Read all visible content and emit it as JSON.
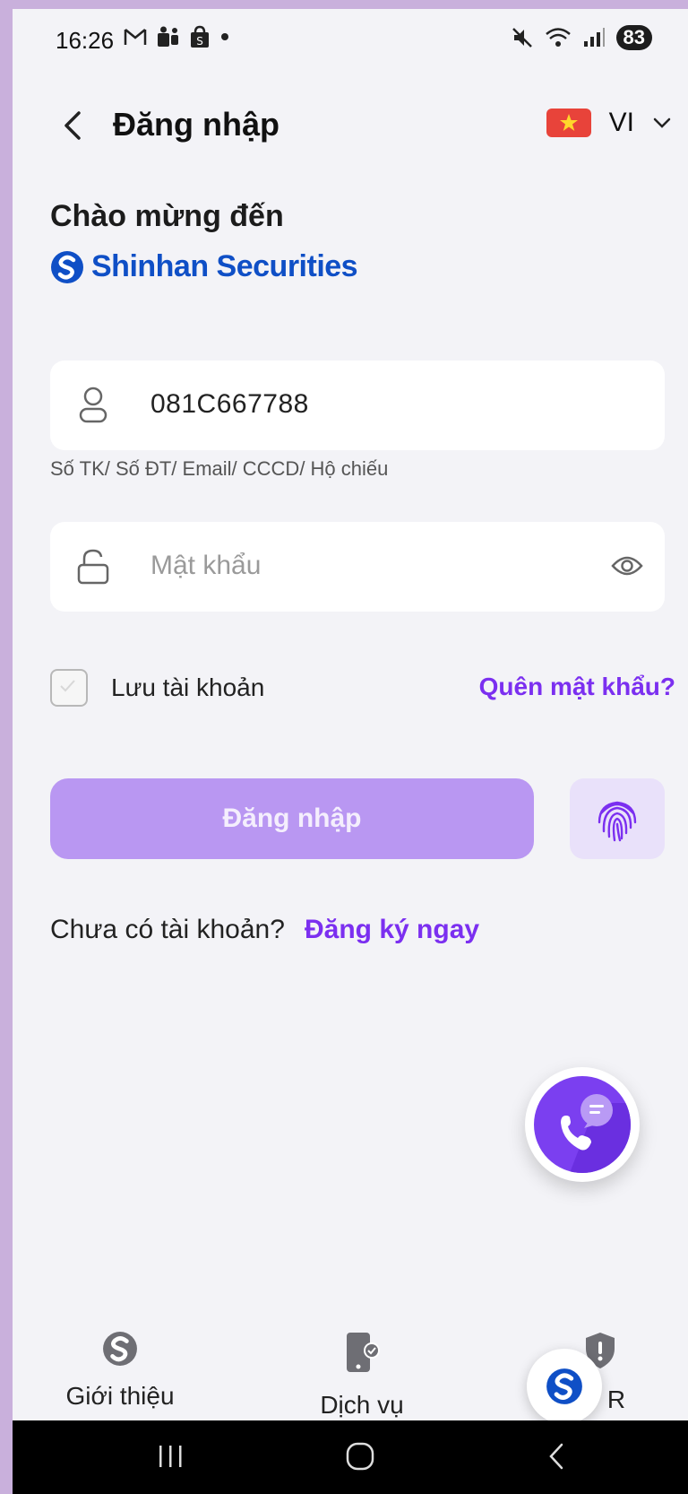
{
  "status_bar": {
    "time": "16:26",
    "battery": "83"
  },
  "header": {
    "title": "Đăng nhập",
    "language": "VI"
  },
  "welcome": {
    "line1": "Chào mừng đến",
    "brand": "Shinhan Securities"
  },
  "account_field": {
    "value": "081C667788",
    "hint": "Số TK/ Số ĐT/ Email/ CCCD/ Hộ chiếu"
  },
  "password_field": {
    "placeholder": "Mật khẩu"
  },
  "remember": {
    "label": "Lưu tài khoản",
    "checked": false
  },
  "forgot_label": "Quên mật khẩu?",
  "login_label": "Đăng nhập",
  "signup": {
    "prompt": "Chưa có tài khoản?",
    "link": "Đăng ký ngay"
  },
  "bottom_nav": [
    {
      "label": "Giới thiệu",
      "icon": "shinhan-logo-icon"
    },
    {
      "label": "Dịch vụ",
      "icon": "phone-check-icon"
    },
    {
      "label": "R",
      "icon": "shield-alert-icon"
    }
  ],
  "colors": {
    "accent": "#7b2ff0",
    "brand_blue": "#0f4fc6",
    "button_disabled": "#b997f2"
  }
}
